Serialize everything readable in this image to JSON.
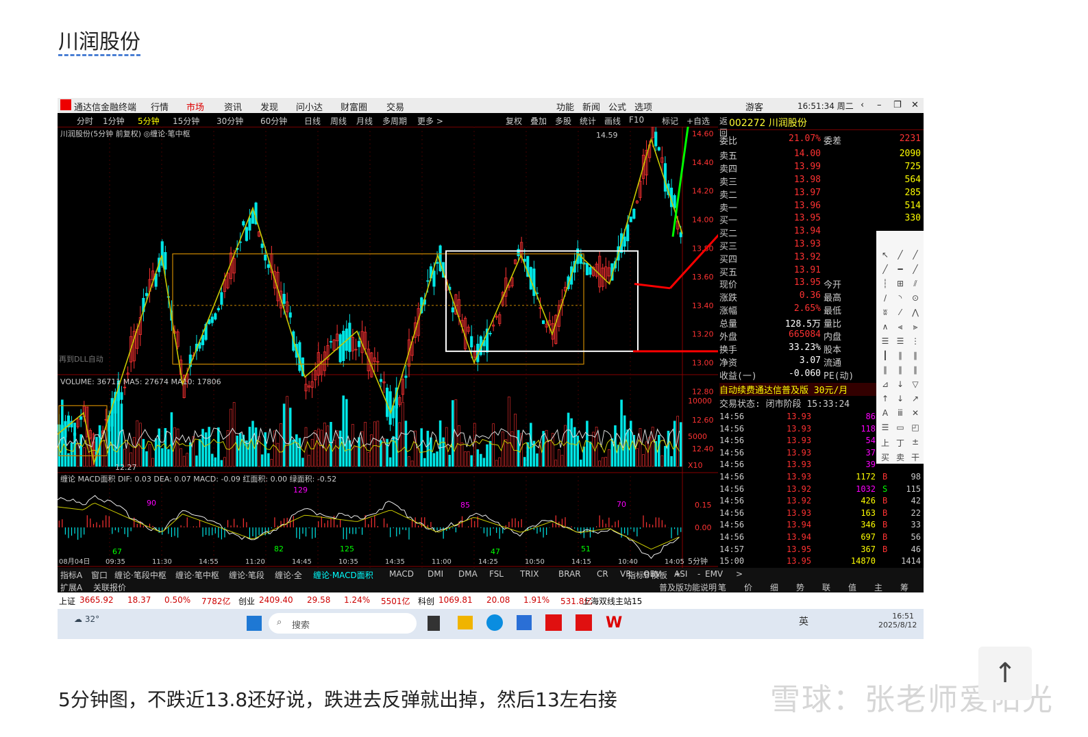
{
  "post": {
    "title": "川润股份",
    "caption": "5分钟图，不跌近13.8还好说，跌进去反弹就出掉，然后13左右接",
    "watermark": "雪球：张老师爱阳光",
    "scroll_top_icon": "arrow-up-icon"
  },
  "app": {
    "name": "通达信金融终端",
    "menu": [
      "行情",
      "市场",
      "资讯",
      "发现",
      "问小达",
      "财富圈",
      "交易"
    ],
    "menu_right": [
      "功能",
      "新闻",
      "公式",
      "选项"
    ],
    "user": "游客",
    "clock": "16:51:34 周二"
  },
  "timeframes": [
    "分时",
    "1分钟",
    "5分钟",
    "15分钟",
    "30分钟",
    "60分钟",
    "日线",
    "周线",
    "月线",
    "多周期",
    "更多 >"
  ],
  "tools_top": [
    "复权",
    "叠加",
    "多股",
    "统计",
    "画线",
    "F10",
    "标记",
    "+自选",
    "返回"
  ],
  "chart": {
    "header": "川润股份(5分钟 前复权) ◎缠论·笔中枢",
    "high_label": "14.59",
    "low_label": "12.27",
    "price_ticks": [
      "14.60",
      "14.40",
      "14.20",
      "14.00",
      "13.80",
      "13.60",
      "13.40",
      "13.20",
      "13.00",
      "12.80",
      "12.60",
      "12.40"
    ],
    "volume_header": "VOLUME: 36711  MA5: 27674  MA10: 17806",
    "volume_ticks": [
      "10000",
      "5000",
      "X10"
    ],
    "macd_header": "缠论 MACD面积  DIF: 0.03  DEA: 0.07  MACD: -0.09  红面积: 0.00  绿面积: -0.52",
    "macd_ticks": [
      "0.15",
      "0.00"
    ],
    "macd_labels": [
      "90",
      "129",
      "85",
      "70",
      "67",
      "82",
      "125",
      "47",
      "51"
    ],
    "time_labels": [
      "08月04日",
      "09:35",
      "11:30",
      "14:55",
      "11:20",
      "14:45",
      "10:35",
      "14:35",
      "11:00",
      "14:25",
      "10:50",
      "14:15",
      "10:40",
      "14:05"
    ],
    "period": "5分钟",
    "left_note": "再到DLL自动"
  },
  "indicator_tabs": [
    "指标A",
    "窗口",
    "缠论·笔段中枢",
    "缠论·笔中枢",
    "缠论·笔段",
    "缠论·全",
    "缠论·MACD面积",
    "MACD",
    "DMI",
    "DMA",
    "FSL",
    "TRIX",
    "BRAR",
    "CR",
    "VR",
    "OBV",
    "ASI",
    "EMV",
    ">",
    "指标B",
    "模板",
    "+",
    "-"
  ],
  "sub_tabs": [
    "扩展A",
    "关联报价"
  ],
  "right_bottom_tabs": [
    "普及版功能说明",
    "笔",
    "价",
    "细",
    "势",
    "联",
    "值",
    "主",
    "筹"
  ],
  "quote": {
    "code_name": "002272 川润股份",
    "weibi_label": "委比",
    "weibi": "21.07%",
    "weicha_label": "委差",
    "weicha": "2231",
    "asks": [
      {
        "label": "卖五",
        "price": "14.00",
        "vol": "2090"
      },
      {
        "label": "卖四",
        "price": "13.99",
        "vol": "725"
      },
      {
        "label": "卖三",
        "price": "13.98",
        "vol": "564"
      },
      {
        "label": "卖二",
        "price": "13.97",
        "vol": "285"
      },
      {
        "label": "卖一",
        "price": "13.96",
        "vol": "514"
      }
    ],
    "bids": [
      {
        "label": "买一",
        "price": "13.95",
        "vol": "330"
      },
      {
        "label": "买二",
        "price": "13.94",
        "vol": ""
      },
      {
        "label": "买三",
        "price": "13.93",
        "vol": ""
      },
      {
        "label": "买四",
        "price": "13.92",
        "vol": ""
      },
      {
        "label": "买五",
        "price": "13.91",
        "vol": ""
      }
    ],
    "stats": [
      {
        "l": "现价",
        "v": "13.95",
        "r": "今开"
      },
      {
        "l": "涨跌",
        "v": "0.36",
        "r": "最高"
      },
      {
        "l": "涨幅",
        "v": "2.65%",
        "r": "最低"
      },
      {
        "l": "总量",
        "v": "128.5万",
        "r": "量比"
      },
      {
        "l": "外盘",
        "v": "665084",
        "r": "内盘"
      },
      {
        "l": "换手",
        "v": "33.23%",
        "r": "股本"
      },
      {
        "l": "净资",
        "v": "3.07",
        "r": "流通"
      },
      {
        "l": "收益(一)",
        "v": "-0.060",
        "r": "PE(动)"
      }
    ],
    "promo": "自动续费通达信普及版  30元/月",
    "trade_status": "交易状态: 闭市阶段 15:33:24",
    "ticks": [
      {
        "t": "14:56",
        "p": "13.93",
        "v": "86",
        "f": "",
        "n": ""
      },
      {
        "t": "14:56",
        "p": "13.93",
        "v": "118",
        "f": "",
        "n": ""
      },
      {
        "t": "14:56",
        "p": "13.93",
        "v": "54",
        "f": "",
        "n": ""
      },
      {
        "t": "14:56",
        "p": "13.93",
        "v": "37",
        "f": "",
        "n": ""
      },
      {
        "t": "14:56",
        "p": "13.93",
        "v": "39",
        "f": "",
        "n": ""
      },
      {
        "t": "14:56",
        "p": "13.93",
        "v": "1172",
        "f": "B",
        "n": "98"
      },
      {
        "t": "14:56",
        "p": "13.92",
        "v": "1032",
        "f": "S",
        "n": "115"
      },
      {
        "t": "14:56",
        "p": "13.92",
        "v": "426",
        "f": "B",
        "n": "42"
      },
      {
        "t": "14:56",
        "p": "13.93",
        "v": "163",
        "f": "B",
        "n": "22"
      },
      {
        "t": "14:56",
        "p": "13.94",
        "v": "346",
        "f": "B",
        "n": "33"
      },
      {
        "t": "14:56",
        "p": "13.94",
        "v": "697",
        "f": "B",
        "n": "56"
      },
      {
        "t": "14:57",
        "p": "13.95",
        "v": "367",
        "f": "B",
        "n": "46"
      },
      {
        "t": "15:00",
        "p": "13.95",
        "v": "14870",
        "f": "",
        "n": "1414"
      }
    ]
  },
  "status_bar": {
    "items": [
      "上证",
      "3665.92",
      "18.37",
      "0.50%",
      "7782亿",
      "创业",
      "2409.40",
      "29.58",
      "1.24%",
      "5501亿",
      "科创",
      "1069.81",
      "20.08",
      "1.91%",
      "531.8亿"
    ],
    "server": "上海双线主站15"
  },
  "taskbar": {
    "weather": "32°",
    "search": "搜索",
    "time": "16:51",
    "date": "2025/8/12",
    "ime": "英"
  },
  "colors": {
    "up": "#ff3232",
    "down": "#00e6e6",
    "yellow": "#ffff00",
    "line_yellow": "#c8c800",
    "annot_red": "#ff0000",
    "annot_green": "#00ff00"
  }
}
